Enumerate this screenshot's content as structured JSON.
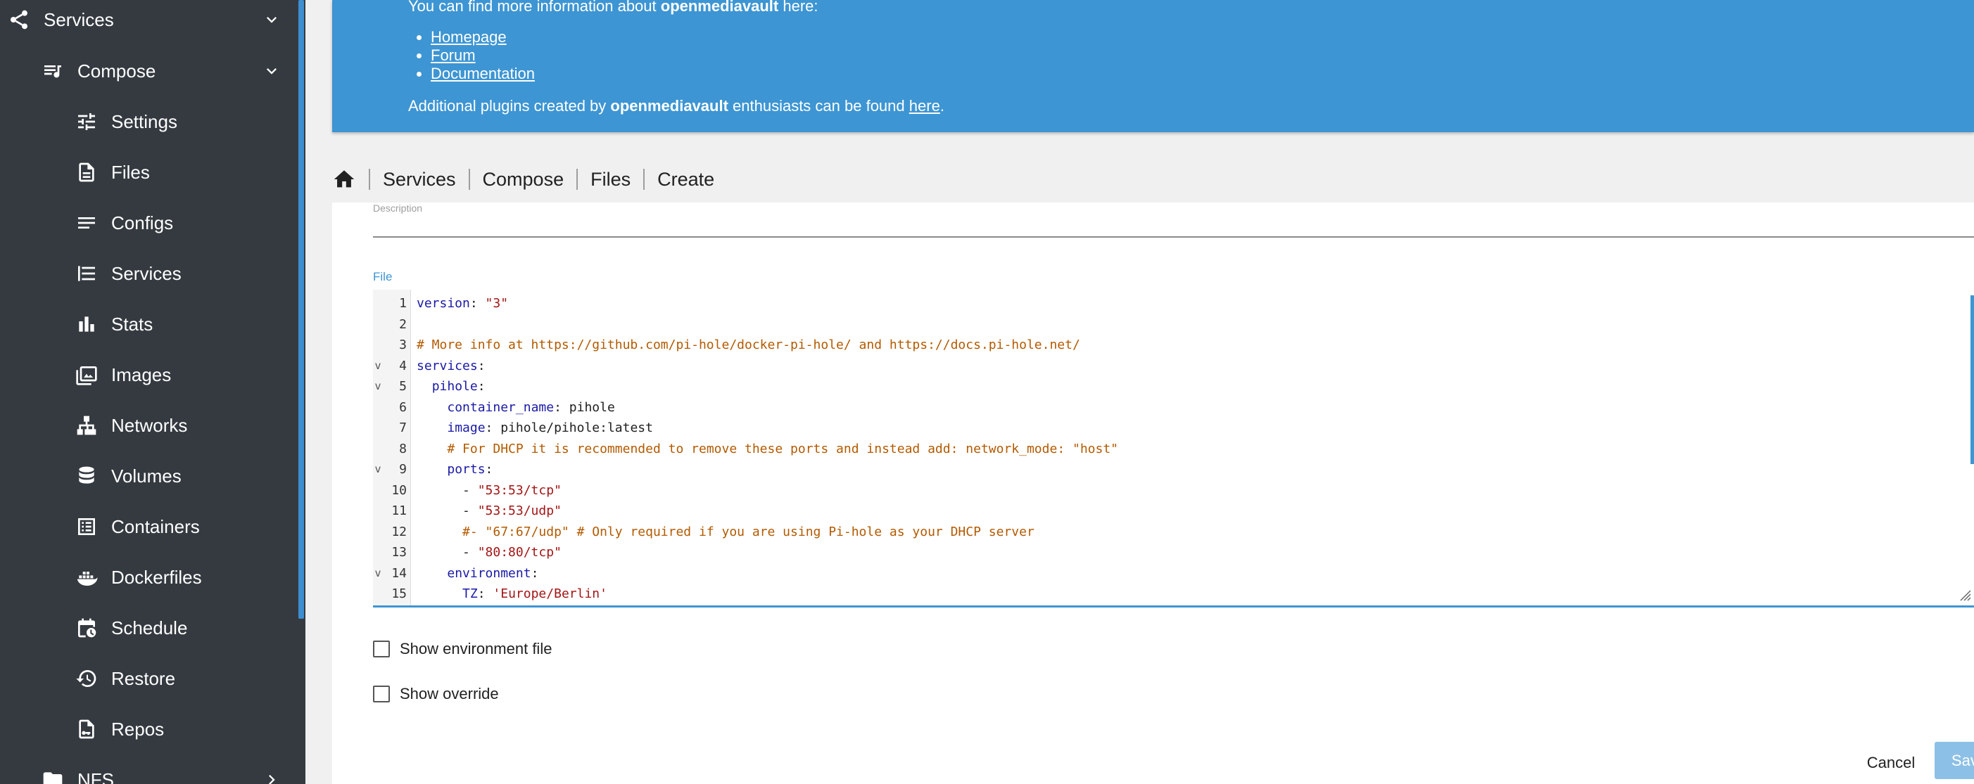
{
  "sidebar": {
    "services": {
      "label": "Services"
    },
    "compose": {
      "label": "Compose"
    },
    "items": [
      {
        "label": "Settings",
        "icon": "tune-icon"
      },
      {
        "label": "Files",
        "icon": "file-icon"
      },
      {
        "label": "Configs",
        "icon": "lines-icon"
      },
      {
        "label": "Services",
        "icon": "list-icon"
      },
      {
        "label": "Stats",
        "icon": "bar-chart-icon"
      },
      {
        "label": "Images",
        "icon": "image-icon"
      },
      {
        "label": "Networks",
        "icon": "network-icon"
      },
      {
        "label": "Volumes",
        "icon": "database-icon"
      },
      {
        "label": "Containers",
        "icon": "container-list-icon"
      },
      {
        "label": "Dockerfiles",
        "icon": "docker-icon"
      },
      {
        "label": "Schedule",
        "icon": "calendar-clock-icon"
      },
      {
        "label": "Restore",
        "icon": "restore-icon"
      },
      {
        "label": "Repos",
        "icon": "repo-icon"
      }
    ],
    "nfs": {
      "label": "NFS"
    }
  },
  "banner": {
    "intro_prefix": "You can find more information about ",
    "intro_brand": "openmediavault",
    "intro_suffix": " here:",
    "links": [
      "Homepage",
      "Forum",
      "Documentation"
    ],
    "extra_prefix": "Additional plugins created by ",
    "extra_brand": "openmediavault",
    "extra_middle": " enthusiasts can be found ",
    "extra_link": "here",
    "extra_suffix": "."
  },
  "breadcrumb": [
    "Services",
    "Compose",
    "Files",
    "Create"
  ],
  "form": {
    "description_label": "Description",
    "file_label": "File",
    "show_env_label": "Show environment file",
    "show_override_label": "Show override",
    "cancel_label": "Cancel",
    "save_label": "Save"
  },
  "editor": {
    "lines": [
      {
        "n": "1",
        "fold": "",
        "tokens": [
          [
            "k",
            "version"
          ],
          [
            "p",
            ": "
          ],
          [
            "s",
            "\"3\""
          ]
        ]
      },
      {
        "n": "2",
        "fold": "",
        "tokens": []
      },
      {
        "n": "3",
        "fold": "",
        "tokens": [
          [
            "c",
            "# More info at https://github.com/pi-hole/docker-pi-hole/ and https://docs.pi-hole.net/"
          ]
        ]
      },
      {
        "n": "4",
        "fold": "v",
        "tokens": [
          [
            "k",
            "services"
          ],
          [
            "p",
            ":"
          ]
        ]
      },
      {
        "n": "5",
        "fold": "v",
        "tokens": [
          [
            "p",
            "  "
          ],
          [
            "k",
            "pihole"
          ],
          [
            "p",
            ":"
          ]
        ]
      },
      {
        "n": "6",
        "fold": "",
        "tokens": [
          [
            "p",
            "    "
          ],
          [
            "k",
            "container_name"
          ],
          [
            "p",
            ": "
          ],
          [
            "v",
            "pihole"
          ]
        ]
      },
      {
        "n": "7",
        "fold": "",
        "tokens": [
          [
            "p",
            "    "
          ],
          [
            "k",
            "image"
          ],
          [
            "p",
            ": "
          ],
          [
            "v",
            "pihole/pihole:latest"
          ]
        ]
      },
      {
        "n": "8",
        "fold": "",
        "tokens": [
          [
            "p",
            "    "
          ],
          [
            "c",
            "# For DHCP it is recommended to remove these ports and instead add: network_mode: \"host\""
          ]
        ]
      },
      {
        "n": "9",
        "fold": "v",
        "tokens": [
          [
            "p",
            "    "
          ],
          [
            "k",
            "ports"
          ],
          [
            "p",
            ":"
          ]
        ]
      },
      {
        "n": "10",
        "fold": "",
        "tokens": [
          [
            "p",
            "      - "
          ],
          [
            "s",
            "\"53:53/tcp\""
          ]
        ]
      },
      {
        "n": "11",
        "fold": "",
        "tokens": [
          [
            "p",
            "      - "
          ],
          [
            "s",
            "\"53:53/udp\""
          ]
        ]
      },
      {
        "n": "12",
        "fold": "",
        "tokens": [
          [
            "p",
            "      "
          ],
          [
            "c",
            "#- \"67:67/udp\" # Only required if you are using Pi-hole as your DHCP server"
          ]
        ]
      },
      {
        "n": "13",
        "fold": "",
        "tokens": [
          [
            "p",
            "      - "
          ],
          [
            "s",
            "\"80:80/tcp\""
          ]
        ]
      },
      {
        "n": "14",
        "fold": "v",
        "tokens": [
          [
            "p",
            "    "
          ],
          [
            "k",
            "environment"
          ],
          [
            "p",
            ":"
          ]
        ]
      },
      {
        "n": "15",
        "fold": "",
        "tokens": [
          [
            "p",
            "      "
          ],
          [
            "k",
            "TZ"
          ],
          [
            "p",
            ": "
          ],
          [
            "s",
            "'Europe/Berlin'"
          ]
        ]
      }
    ]
  }
}
